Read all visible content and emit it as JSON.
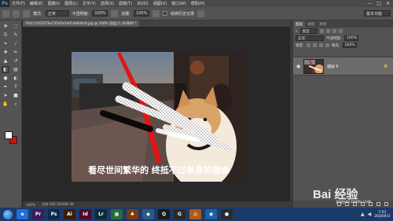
{
  "app": {
    "logo": "Ps",
    "menu": [
      "文件(F)",
      "编辑(E)",
      "图像(I)",
      "图层(L)",
      "文字(Y)",
      "选择(S)",
      "滤镜(T)",
      "3D(D)",
      "视图(V)",
      "窗口(W)",
      "帮助(H)"
    ],
    "window_controls": [
      "—",
      "□",
      "✕"
    ]
  },
  "options": {
    "mode_label": "模式:",
    "mode_value": "正常",
    "opacity_label": "不透明度:",
    "opacity_value": "100%",
    "flow_label": "流量:",
    "flow_value": "100%",
    "history_label": "绘到历史记录",
    "workspace": "基本功能"
  },
  "document": {
    "tab_title": "7b5c7a55257ba735d3a7dd7a6644c9.jpg @ 100% (图层 0, RGB/8) *",
    "zoom": "100%",
    "doc_size": "文档:366.2K/488.3K"
  },
  "image": {
    "caption": "看尽世间繁华的 终抵不过单身的宿命"
  },
  "colors": {
    "foreground": "#ffffff",
    "background": "#d01010",
    "taskbar": "#1c3a68",
    "accent": "#31a8ff"
  },
  "tools": [
    "move",
    "marquee",
    "lasso",
    "quick-select",
    "crop",
    "eyedropper",
    "healing",
    "brush",
    "stamp",
    "history-brush",
    "eraser",
    "gradient",
    "blur",
    "dodge",
    "pen",
    "type",
    "path-select",
    "shape",
    "hand",
    "zoom"
  ],
  "layers_panel": {
    "tabs": [
      "图层",
      "通道",
      "路径"
    ],
    "kind_label": "类型",
    "blend_mode": "正常",
    "opacity_label": "不透明度:",
    "opacity_value": "100%",
    "lock_label": "锁定:",
    "fill_label": "填充:",
    "fill_value": "100%",
    "layer_name": "图层 0"
  },
  "taskbar": {
    "apps": [
      {
        "label": "e",
        "color": "#1e6fd9"
      },
      {
        "label": "Pr",
        "color": "#3b1a5e"
      },
      {
        "label": "Ps",
        "color": "#0e2a4a"
      },
      {
        "label": "Ai",
        "color": "#3a2008"
      },
      {
        "label": "Id",
        "color": "#4a0d2a"
      },
      {
        "label": "Lr",
        "color": "#0e2a3a"
      },
      {
        "label": "▦",
        "color": "#2d6a3a"
      },
      {
        "label": "♣",
        "color": "#7a3a10"
      },
      {
        "label": "◆",
        "color": "#2a5a8a"
      },
      {
        "label": "Q",
        "color": "#1a1a1a"
      },
      {
        "label": "G",
        "color": "#2a2a2a"
      },
      {
        "label": "◎",
        "color": "#b05a10"
      },
      {
        "label": "◉",
        "color": "#1e5fa0"
      },
      {
        "label": "●",
        "color": "#2a2a2a"
      }
    ],
    "clock_time": "7:53",
    "clock_date": "2020/4/3"
  },
  "watermark": {
    "brand": "Bai 经验",
    "url": "jingyan.baidu.com"
  }
}
